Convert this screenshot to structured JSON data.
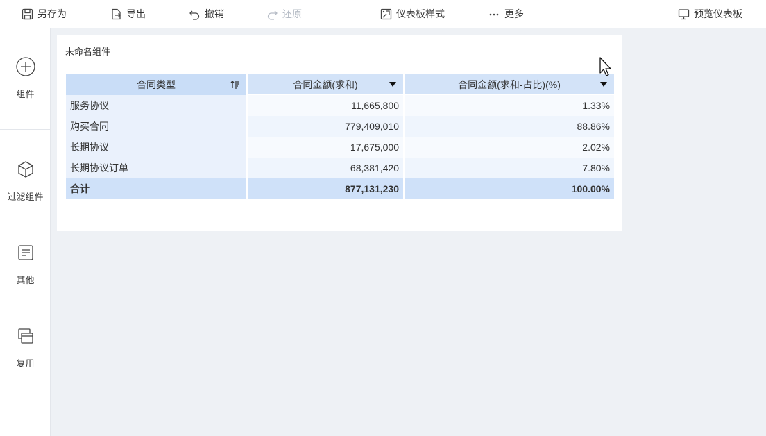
{
  "toolbar": {
    "save_as": "另存为",
    "export": "导出",
    "undo": "撤销",
    "redo": "还原",
    "dashboard_style": "仪表板样式",
    "more": "更多",
    "preview": "预览仪表板"
  },
  "sidebar": {
    "items": [
      {
        "label": "组件",
        "icon": "plus-circle-icon"
      },
      {
        "label": "过滤组件",
        "icon": "cube-icon"
      },
      {
        "label": "其他",
        "icon": "document-icon"
      },
      {
        "label": "复用",
        "icon": "copy-icon"
      }
    ]
  },
  "widget": {
    "title": "未命名组件",
    "table": {
      "headers": [
        "合同类型",
        "合同金额(求和)",
        "合同金额(求和-占比)(%)"
      ],
      "rows": [
        [
          "服务协议",
          "11,665,800",
          "1.33%"
        ],
        [
          "购买合同",
          "779,409,010",
          "88.86%"
        ],
        [
          "长期协议",
          "17,675,000",
          "2.02%"
        ],
        [
          "长期协议订单",
          "68,381,420",
          "7.80%"
        ]
      ],
      "total": [
        "合计",
        "877,131,230",
        "100.00%"
      ]
    }
  },
  "colors": {
    "header_bg": "#d3e3f8",
    "total_bg": "#cfe1f9",
    "canvas_bg": "#eef1f5",
    "disabled_text": "#b6bcc6"
  }
}
